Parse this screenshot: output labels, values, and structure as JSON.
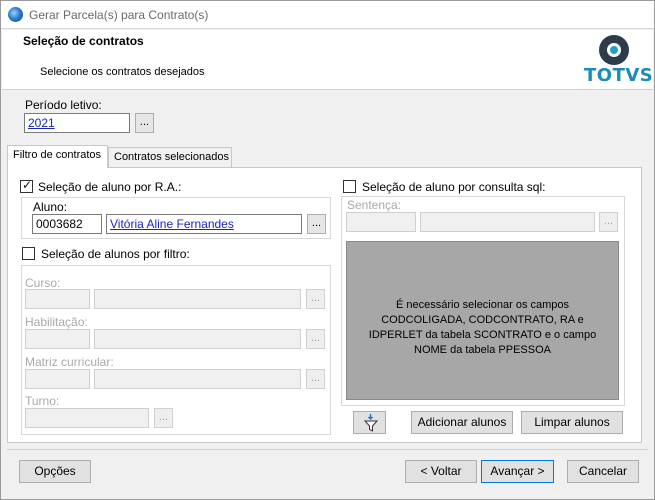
{
  "window": {
    "title": "Gerar Parcela(s) para Contrato(s)"
  },
  "header": {
    "title": "Seleção de contratos",
    "subtitle": "Selecione os contratos desejados",
    "logo_text": "TOTVS"
  },
  "periodo": {
    "label": "Período letivo:",
    "value": "2021",
    "browse_label": "..."
  },
  "tabs": [
    {
      "label": "Filtro de contratos",
      "active": true
    },
    {
      "label": "Contratos selecionados",
      "active": false
    }
  ],
  "ra_section": {
    "checkbox_label": "Seleção de aluno por R.A.:",
    "checked": true,
    "aluno_label": "Aluno:",
    "aluno_code": "0003682",
    "aluno_name": "Vitória Aline Fernandes",
    "browse_label": "..."
  },
  "filtro_section": {
    "checkbox_label": "Seleção de alunos por filtro:",
    "checked": false,
    "curso_label": "Curso:",
    "habilitacao_label": "Habilitação:",
    "matriz_label": "Matriz curricular:",
    "turno_label": "Turno:",
    "browse_label": "..."
  },
  "sql_section": {
    "checkbox_label": "Seleção de aluno por consulta sql:",
    "checked": false,
    "sentenca_label": "Sentença:",
    "browse_label": "...",
    "message": "É necessário selecionar os campos CODCOLIGADA, CODCONTRATO, RA e IDPERLET da tabela SCONTRATO e o campo NOME da tabela PPESSOA"
  },
  "actions": {
    "add_label": "Adicionar alunos",
    "clear_label": "Limpar alunos",
    "filter_icon": "filter-icon"
  },
  "footer": {
    "options_label": "Opções",
    "back_label": "< Voltar",
    "next_label": "Avançar >",
    "cancel_label": "Cancelar"
  },
  "colors": {
    "link": "#1a25b8",
    "logo": "#1a8cb5",
    "panel_gray": "#a7a7a7"
  }
}
